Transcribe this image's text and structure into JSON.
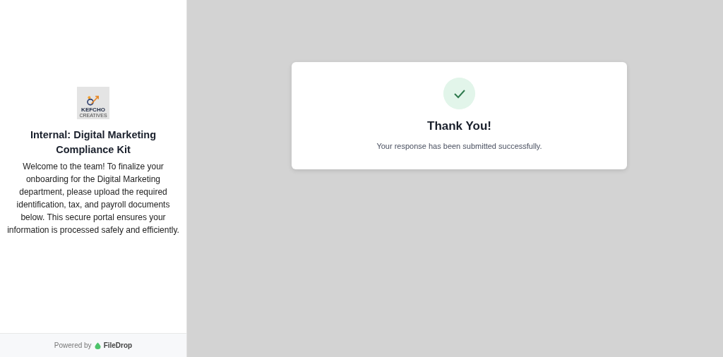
{
  "sidebar": {
    "logo": {
      "name": "KEFCHO",
      "subtitle": "CREATIVES"
    },
    "title": "Internal: Digital Marketing Compliance Kit",
    "description": "Welcome to the team! To finalize your onboarding for the Digital Marketing department, please upload the required identification, tax, and payroll documents below. This secure portal ensures your information is processed safely and efficiently.",
    "footer": {
      "prefix": "Powered by",
      "brand": "FileDrop"
    }
  },
  "confirmation": {
    "title": "Thank You!",
    "message": "Your response has been submitted successfully."
  }
}
